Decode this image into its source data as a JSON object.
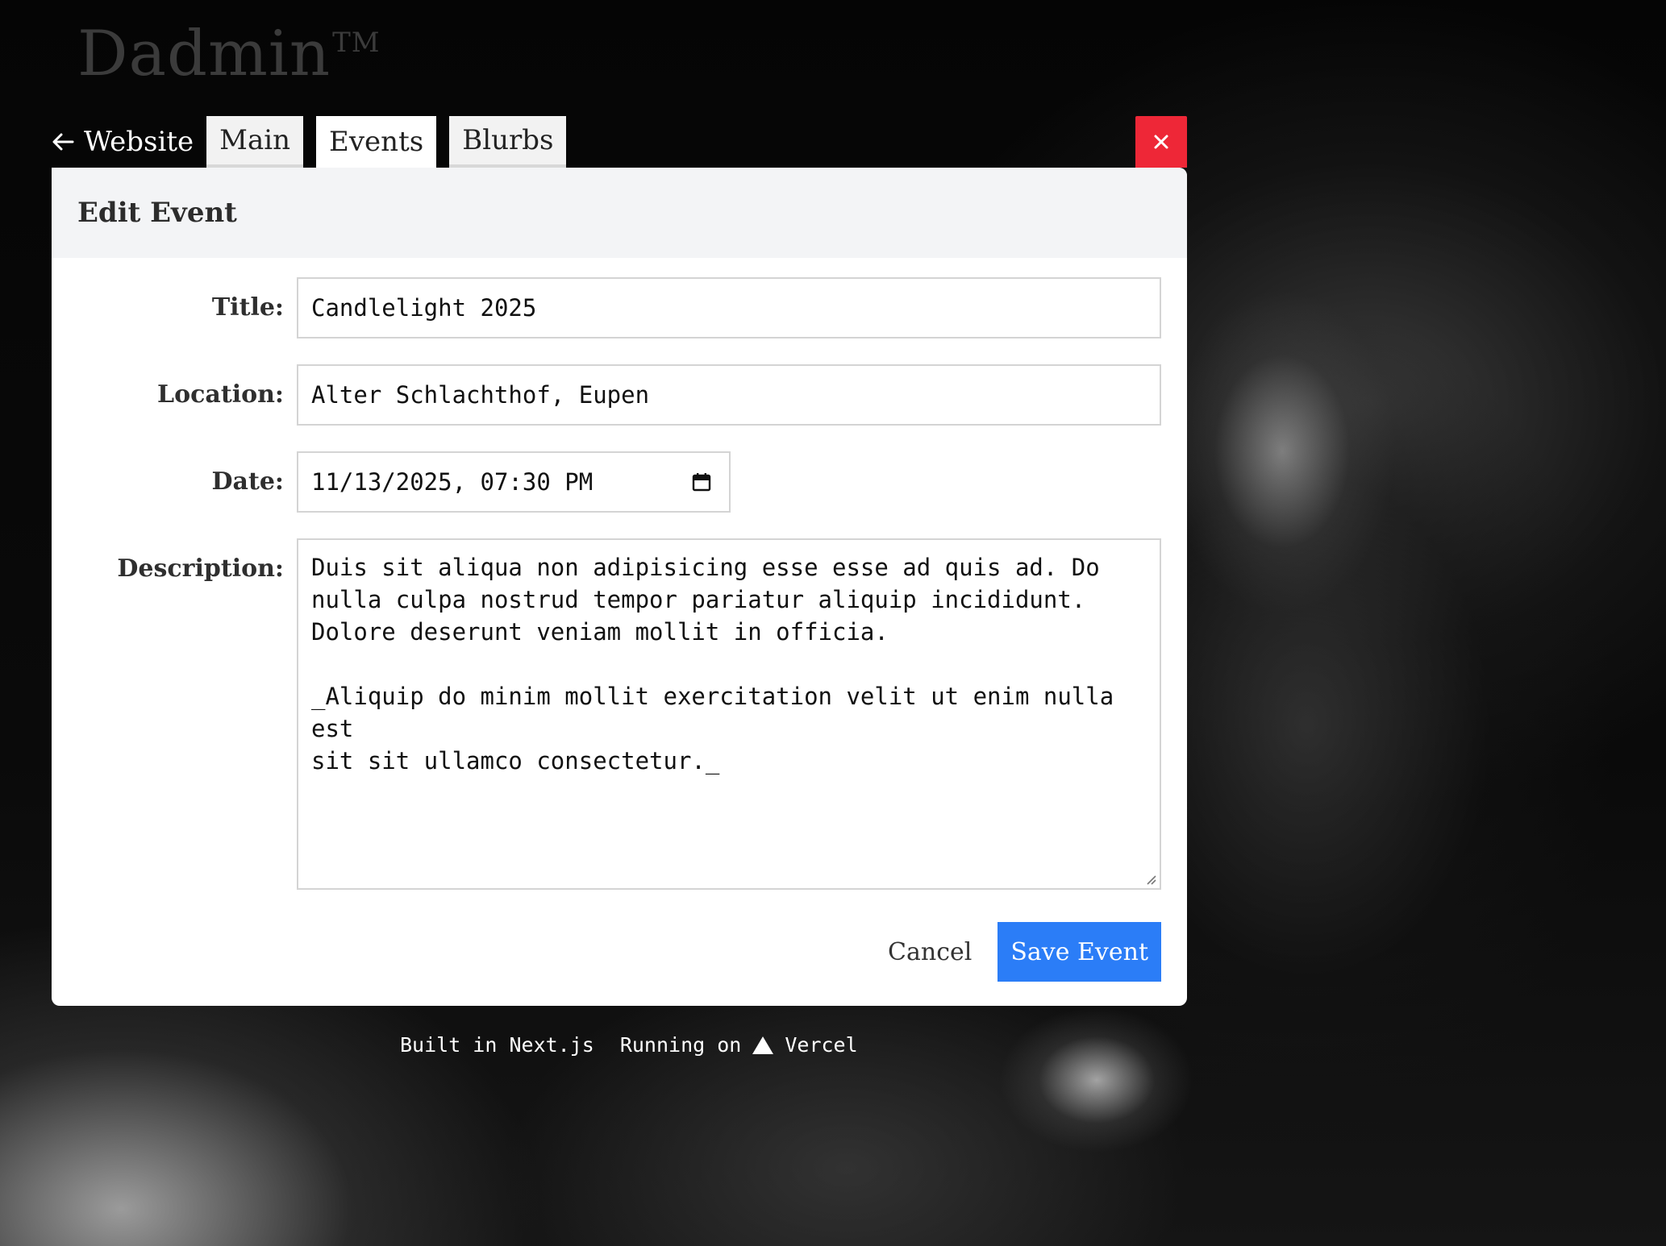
{
  "app": {
    "title": "Dadmin",
    "trademark": "TM"
  },
  "nav": {
    "back_label": "Website",
    "tabs": [
      {
        "label": "Main"
      },
      {
        "label": "Events"
      },
      {
        "label": "Blurbs"
      }
    ],
    "active_tab": "Events",
    "close_label": "×"
  },
  "card": {
    "heading": "Edit Event"
  },
  "form": {
    "title_label": "Title:",
    "title_value": "Candlelight 2025",
    "location_label": "Location:",
    "location_value": "Alter Schlachthof, Eupen",
    "date_label": "Date:",
    "date_value": "11/13/2025, 07:30 PM",
    "description_label": "Description:",
    "description_value": "Duis sit aliqua non adipisicing esse esse ad quis ad. Do\nnulla culpa nostrud tempor pariatur aliquip incididunt.\nDolore deserunt veniam mollit in officia.\n\n_Aliquip do minim mollit exercitation velit ut enim nulla est\nsit sit ullamco consectetur._"
  },
  "actions": {
    "cancel_label": "Cancel",
    "save_label": "Save Event"
  },
  "footer": {
    "built_text": "Built in Next.js",
    "running_text": "Running on",
    "vercel_text": "Vercel"
  },
  "colors": {
    "close_bg": "#ee2737",
    "save_bg": "#2b7df7",
    "header_bg": "#f3f4f6"
  },
  "icons": {
    "back": "arrow-left-icon",
    "close": "close-icon",
    "calendar": "calendar-icon",
    "vercel": "vercel-triangle-icon"
  }
}
